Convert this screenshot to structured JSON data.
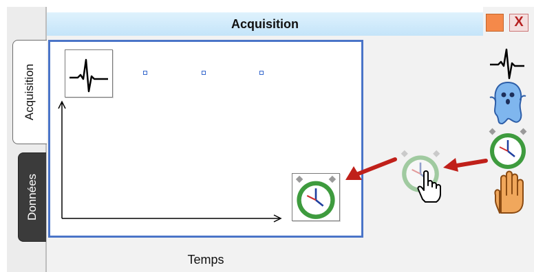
{
  "tabs": [
    {
      "label": "Acquisition",
      "active": true
    },
    {
      "label": "Données",
      "active": false
    }
  ],
  "header": {
    "title": "Acquisition"
  },
  "window_controls": {
    "close_glyph": "X"
  },
  "plot": {
    "bottom_label": "Temps"
  },
  "icons": {
    "signal": "ecg-signal-icon",
    "ghost": "ghost-icon",
    "timer": "stopwatch-icon",
    "hand": "hand-icon",
    "drag_cursor": "pointer-hand-icon"
  },
  "colors": {
    "header_bg": "#cfe9fb",
    "plot_border": "#4a74c8",
    "arrow": "#c0201a",
    "close_button": "#b52020",
    "pause_button": "#f5894a"
  }
}
